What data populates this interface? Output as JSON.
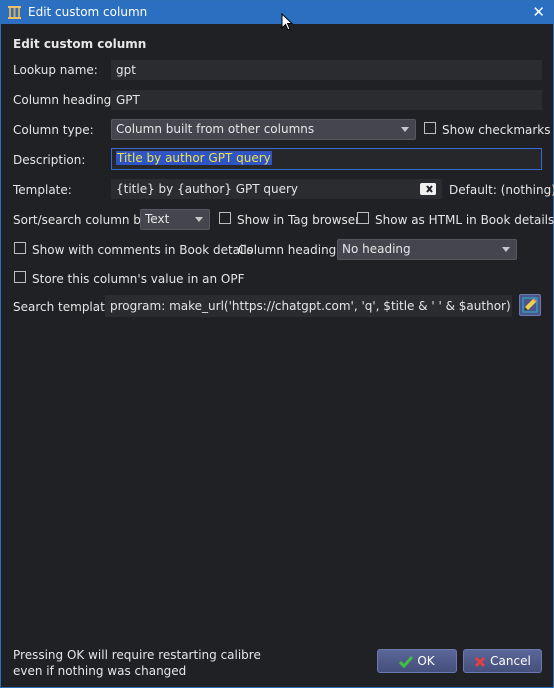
{
  "window": {
    "title": "Edit custom column",
    "close_glyph": "✕"
  },
  "heading": "Edit custom column",
  "lookup": {
    "label": "Lookup name:",
    "value": "gpt"
  },
  "column_heading": {
    "label": "Column heading:",
    "value": "GPT"
  },
  "column_type": {
    "label": "Column type:",
    "value": "Column built from other columns",
    "checkbox_label": "Show checkmarks"
  },
  "description": {
    "label": "Description:",
    "value": "Title by author GPT query"
  },
  "template": {
    "label": "Template:",
    "value": "{title} by {author} GPT query",
    "default_text": "Default: (nothing)"
  },
  "sort": {
    "label": "Sort/search column by",
    "value": "Text",
    "tag_browser_label": "Show in Tag browser",
    "html_label": "Show as HTML in Book details"
  },
  "comments": {
    "label": "Show with comments in Book details",
    "heading_label": "Column heading:",
    "heading_value": "No heading"
  },
  "opf": {
    "label": "Store this column's value in an OPF"
  },
  "search_template": {
    "label": "Search template:",
    "value": "program: make_url('https://chatgpt.com', 'q', $title  & ' ' & $author)"
  },
  "footer": {
    "line1": "Pressing OK will require restarting calibre",
    "line2": "even if nothing was changed"
  },
  "buttons": {
    "ok": "OK",
    "cancel": "Cancel"
  },
  "colors": {
    "titlebar": "#2b6fc1",
    "background": "#202125",
    "selection": "#2f54c4",
    "ok_check": "#3fbf3f",
    "cancel_x": "#e04040"
  }
}
